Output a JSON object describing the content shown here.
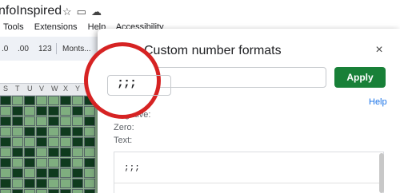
{
  "spreadsheet": {
    "title": "nfoInspired",
    "title_icons": [
      "star-icon",
      "folder-icon",
      "cloud-icon"
    ],
    "menu": [
      "Tools",
      "Extensions",
      "Help",
      "Accessibility"
    ],
    "toolbar": {
      "decrease_decimal": ".0",
      "increase_decimal": ".00",
      "more_formats": "123",
      "font": "Monts..."
    },
    "columns": [
      "S",
      "T",
      "U",
      "V",
      "W",
      "X",
      "Y",
      "Z"
    ]
  },
  "dialog": {
    "title": "Custom number formats",
    "close_label": "×",
    "format_value": ";;;",
    "apply_label": "Apply",
    "help_label": "Help",
    "preview_labels": [
      "Negative:",
      "Zero:",
      "Text:"
    ],
    "preview_value": ";;;"
  },
  "annotation": {
    "color": "#d62323",
    "shape": "circle"
  },
  "colors": {
    "apply_button": "#188038",
    "help_link": "#1a73e8",
    "grid_dark": "#0f3a1d",
    "grid_light": "#7fae7f"
  }
}
